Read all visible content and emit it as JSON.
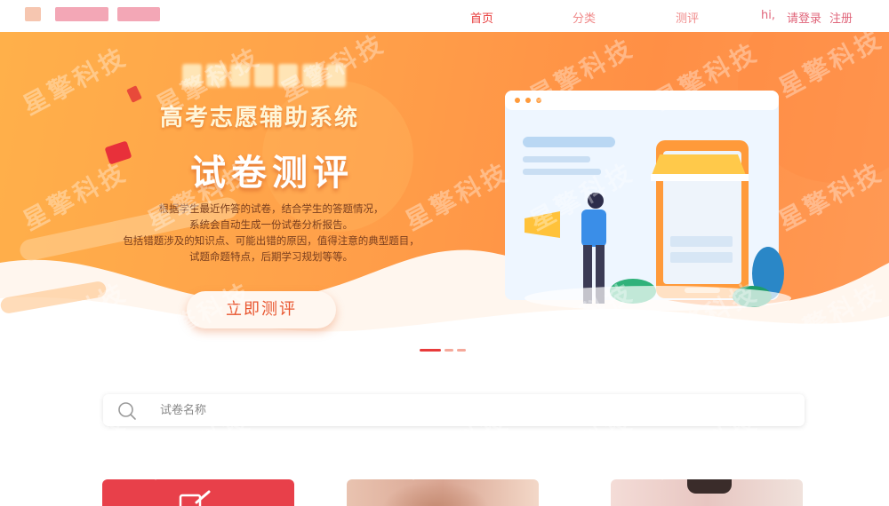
{
  "header": {
    "logo_colors": [
      "#f6c6b0",
      "#f3a7b6",
      "#f3a7b6"
    ],
    "nav": [
      {
        "label": "首页",
        "active": true
      },
      {
        "label": "分类",
        "active": false
      },
      {
        "label": "测评",
        "active": false
      }
    ],
    "greeting": "hi,",
    "login": "请登录",
    "register": "注册"
  },
  "banner": {
    "system_title": "高考志愿辅助系统",
    "main_title": "试卷测评",
    "description_lines": [
      "根据学生最近作答的试卷，结合学生的答题情况，",
      "系统会自动生成一份试卷分析报告。",
      "包括错题涉及的知识点、可能出错的原因，值得注意的典型题目，",
      "试题命题特点，后期学习规划等等。"
    ],
    "cta_label": "立即测评",
    "carousel_slides": 3,
    "carousel_active": 0
  },
  "search": {
    "placeholder": "试卷名称",
    "value": ""
  },
  "watermark": "星擎科技",
  "colors": {
    "brand_red": "#e83b3b",
    "nav_pink": "#f08a8a",
    "banner_orange": "#ff9a4a",
    "card_red": "#e8404a"
  }
}
